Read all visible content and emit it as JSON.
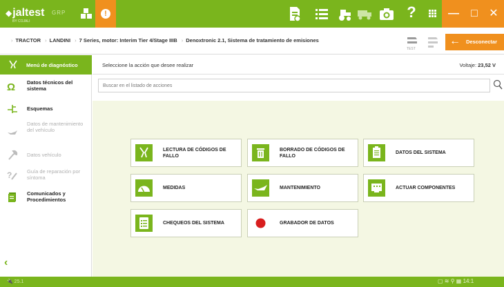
{
  "topbar": {
    "logo_text": "jaltest",
    "logo_subtext": "BY COJALI",
    "grp_label": "GRP",
    "alert_symbol": "!",
    "minimize_symbol": "—",
    "maximize_symbol": "□",
    "close_symbol": "✕",
    "help_symbol": "?"
  },
  "breadcrumb": {
    "items": [
      "TRACTOR",
      "LANDINI",
      "7 Series, motor: Interim Tier 4/Stage IIIB",
      "Denoxtronic 2.1, Sistema de tratamiento de emisiones"
    ]
  },
  "disconnect": {
    "label": "Desconectar"
  },
  "test_label": "TEST",
  "sidebar": {
    "header": "Menú de diagnóstico",
    "items": [
      {
        "label": "Datos técnicos del sistema",
        "state": "active",
        "icon": "omega-icon"
      },
      {
        "label": "Esquemas",
        "state": "active",
        "icon": "schematic-icon"
      },
      {
        "label": "Datos de mantenimiento del vehículo",
        "state": "disabled",
        "icon": "oil-can-icon"
      },
      {
        "label": "Datos vehículo",
        "state": "disabled",
        "icon": "wrench-icon"
      },
      {
        "label": "Guía de reparación por síntoma",
        "state": "disabled",
        "icon": "repair-guide-icon"
      },
      {
        "label": "Comunicados y Procedimientos",
        "state": "active",
        "icon": "documents-icon"
      }
    ],
    "back_symbol": "‹"
  },
  "main": {
    "prompt": "Seleccione la acción que desee realizar",
    "voltage_label": "Voltaje:",
    "voltage_value": "23,52 V",
    "search_placeholder": "Buscar en el listado de acciones"
  },
  "actions": [
    {
      "label": "LECTURA DE CÓDIGOS DE FALLO",
      "icon": "fault-read-icon"
    },
    {
      "label": "BORRADO DE CÓDIGOS DE FALLO",
      "icon": "trash-icon"
    },
    {
      "label": "DATOS DEL SISTEMA",
      "icon": "clipboard-icon"
    },
    {
      "label": "MEDIDAS",
      "icon": "gauge-icon"
    },
    {
      "label": "MANTENIMIENTO",
      "icon": "oil-can-icon"
    },
    {
      "label": "ACTUAR COMPONENTES",
      "icon": "component-icon"
    },
    {
      "label": "CHEQUEOS DEL SISTEMA",
      "icon": "checklist-icon"
    },
    {
      "label": "GRABADOR DE DATOS",
      "icon": "record-icon"
    }
  ],
  "status": {
    "left_text": "25.1",
    "time": "14:1"
  },
  "colors": {
    "brand_green": "#7ab51d",
    "accent_orange": "#f0901e",
    "content_bg": "#f4f7e3",
    "record_red": "#d81e1e"
  }
}
